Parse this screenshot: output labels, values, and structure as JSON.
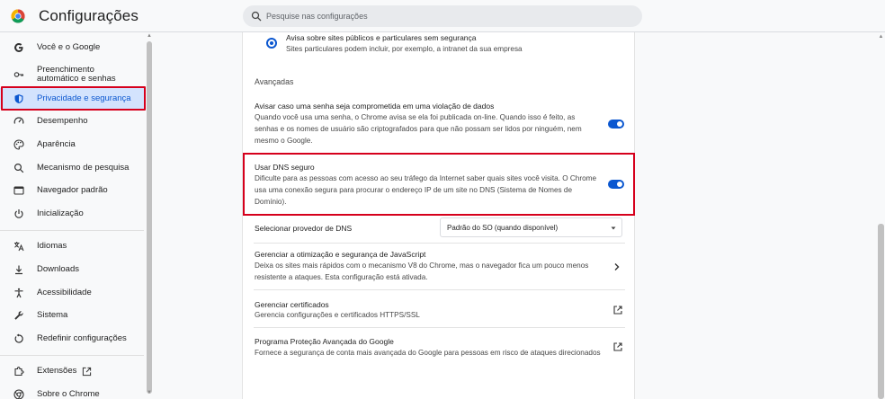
{
  "app": {
    "title": "Configurações"
  },
  "search": {
    "placeholder": "Pesquise nas configurações"
  },
  "sidebar": {
    "items": [
      {
        "label": "Você e o Google",
        "icon": "google-icon"
      },
      {
        "label": "Preenchimento automático e senhas",
        "icon": "key-icon"
      },
      {
        "label": "Privacidade e segurança",
        "icon": "shield-icon",
        "active": true
      },
      {
        "label": "Desempenho",
        "icon": "speedometer-icon"
      },
      {
        "label": "Aparência",
        "icon": "palette-icon"
      },
      {
        "label": "Mecanismo de pesquisa",
        "icon": "search-icon"
      },
      {
        "label": "Navegador padrão",
        "icon": "browser-window-icon"
      },
      {
        "label": "Inicialização",
        "icon": "power-icon"
      },
      {
        "label": "Idiomas",
        "icon": "translate-icon"
      },
      {
        "label": "Downloads",
        "icon": "download-icon"
      },
      {
        "label": "Acessibilidade",
        "icon": "accessibility-icon"
      },
      {
        "label": "Sistema",
        "icon": "wrench-icon"
      },
      {
        "label": "Redefinir configurações",
        "icon": "reset-icon"
      },
      {
        "label": "Extensões",
        "icon": "puzzle-icon"
      },
      {
        "label": "Sobre o Chrome",
        "icon": "chrome-icon"
      }
    ]
  },
  "main": {
    "radio_option": {
      "title": "Avisa sobre sites públicos e particulares sem segurança",
      "desc": "Sites particulares podem incluir, por exemplo, a intranet da sua empresa"
    },
    "section_title": "Avançadas",
    "breach_warning": {
      "title": "Avisar caso uma senha seja comprometida em uma violação de dados",
      "desc_lines": [
        "Quando você usa uma senha, o Chrome avisa se ela foi publicada on-line. Quando isso é feito, as",
        "senhas e os nomes de usuário são criptografados para que não possam ser lidos por ninguém, nem",
        "mesmo o Google."
      ],
      "enabled": true
    },
    "secure_dns": {
      "title": "Usar DNS seguro",
      "desc_lines": [
        "Dificulte para as pessoas com acesso ao seu tráfego da Internet saber quais sites você visita. O Chrome",
        "usa uma conexão segura para procurar o endereço IP de um site no DNS (Sistema de Nomes de",
        "Domínio)."
      ],
      "enabled": true
    },
    "dns_provider": {
      "label": "Selecionar provedor de DNS",
      "selected": "Padrão do SO (quando disponível)"
    },
    "javascript": {
      "title": "Gerenciar a otimização e segurança de JavaScript",
      "desc_lines": [
        "Deixa os sites mais rápidos com o mecanismo V8 do Chrome, mas o navegador fica um pouco menos",
        "resistente a ataques. Esta configuração está ativada."
      ]
    },
    "certificates": {
      "title": "Gerenciar certificados",
      "desc": "Gerencia configurações e certificados HTTPS/SSL"
    },
    "advanced_protection": {
      "title": "Programa Proteção Avançada do Google",
      "desc": "Fornece a segurança de conta mais avançada do Google para pessoas em risco de ataques direcionados"
    }
  },
  "colors": {
    "accent": "#0b57d0",
    "active_nav_bg": "#d3e3fd",
    "highlight_border": "#d6001c"
  }
}
